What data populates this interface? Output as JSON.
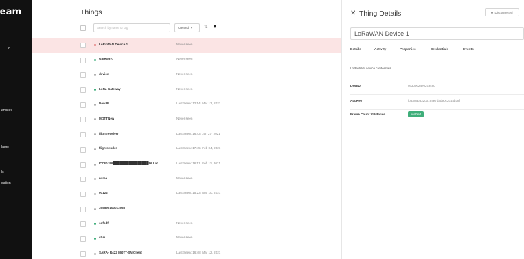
{
  "sidebar": {
    "brand": "ream",
    "items": [
      {
        "label": "d"
      },
      {
        "label": "ervices"
      },
      {
        "label": "laner"
      },
      {
        "label": "ls"
      },
      {
        "label": "dation"
      }
    ]
  },
  "list": {
    "title": "Things",
    "search_placeholder": "Search by name or tag",
    "sort_label": "Created",
    "sort_caret": "▾",
    "sort_toggle_icon": "sort-toggle-icon",
    "filter_icon": "filter-icon",
    "rows": [
      {
        "name": "LoRaWAN Device 1",
        "seen": "Never seen",
        "status": "selected",
        "dot": "#e07070"
      },
      {
        "name": "Gateway1",
        "seen": "Never seen",
        "status": "online",
        "dot": "#3fae7a"
      },
      {
        "name": "device",
        "seen": "Never seen",
        "status": "offline",
        "dot": "#b0b0b0"
      },
      {
        "name": "LoRa Gateway",
        "seen": "Never seen",
        "status": "online",
        "dot": "#3fae7a"
      },
      {
        "name": "New IP",
        "seen": "Last Seen: 12:54, Mar 13, 2021",
        "status": "offline",
        "dot": "#b0b0b0"
      },
      {
        "name": "MQTTNew",
        "seen": "Never seen",
        "status": "offline",
        "dot": "#b0b0b0"
      },
      {
        "name": "flightreceiver",
        "seen": "Last Seen: 16:43, Jan 27, 2021",
        "status": "offline",
        "dot": "#b0b0b0"
      },
      {
        "name": "flightsender",
        "seen": "Last Seen: 17:45, Feb 04, 2021",
        "status": "offline",
        "dot": "#b0b0b0"
      },
      {
        "name": "ICCID: 89████████████████86 Lat...",
        "seen": "Last Seen: 16:51, Feb 11, 2021",
        "status": "offline",
        "dot": "#b0b0b0"
      },
      {
        "name": "name",
        "seen": "Never seen",
        "status": "offline",
        "dot": "#b0b0b0"
      },
      {
        "name": "00122",
        "seen": "Last Seen: 15:23, Mar 10, 2021",
        "status": "offline",
        "dot": "#b0b0b0"
      },
      {
        "name": "355590100011958",
        "seen": "",
        "status": "offline",
        "dot": "#b0b0b0"
      },
      {
        "name": "sdfsdf",
        "seen": "Never seen",
        "status": "online",
        "dot": "#3fae7a"
      },
      {
        "name": "shsi",
        "seen": "Never seen",
        "status": "online",
        "dot": "#3fae7a"
      },
      {
        "name": "SARA- R422 MQTT-SN Client",
        "seen": "Last Seen: 16:48, Mar 12, 2021",
        "status": "offline",
        "dot": "#b0b0b0"
      }
    ]
  },
  "details": {
    "close_icon": "close-icon",
    "title": "Thing Details",
    "connection_status": "Disconnected",
    "device_name": "LoRaWAN Device 1",
    "tabs": [
      {
        "label": "Details"
      },
      {
        "label": "Activity"
      },
      {
        "label": "Properties"
      },
      {
        "label": "Credentials",
        "active": true
      },
      {
        "label": "Events"
      }
    ],
    "section_heading": "LoRaWAN device credentials",
    "fields": [
      {
        "key": "DevEUI",
        "value": "c6309c2ae02cac9d"
      },
      {
        "key": "AppKey",
        "value": "fb330ab332c0194e7dad90c2c44b38f"
      },
      {
        "key": "Frame Count Validation",
        "badge": "enabled"
      }
    ]
  },
  "colors": {
    "sidebar_bg": "#111111",
    "selected_row_bg": "#fbe4e4",
    "accent": "#d04040",
    "enabled_badge": "#3fae7a"
  }
}
